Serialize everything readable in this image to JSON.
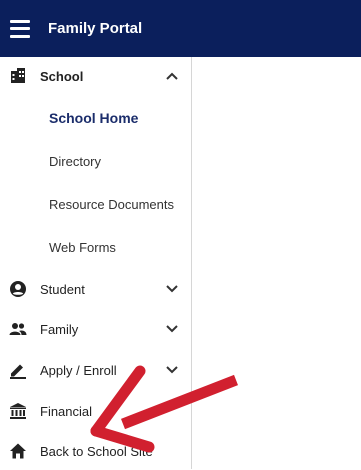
{
  "header": {
    "title": "Family Portal"
  },
  "sidebar": {
    "school": {
      "label": "School"
    },
    "school_subitems": [
      {
        "label": "School Home"
      },
      {
        "label": "Directory"
      },
      {
        "label": "Resource Documents"
      },
      {
        "label": "Web Forms"
      }
    ],
    "student": {
      "label": "Student"
    },
    "family": {
      "label": "Family"
    },
    "apply": {
      "label": "Apply / Enroll"
    },
    "financial": {
      "label": "Financial"
    },
    "back": {
      "label": "Back to School Site"
    }
  },
  "colors": {
    "header_bg": "#0b1f5c",
    "active_text": "#1b2d6b",
    "annotation_arrow": "#d1202f"
  }
}
